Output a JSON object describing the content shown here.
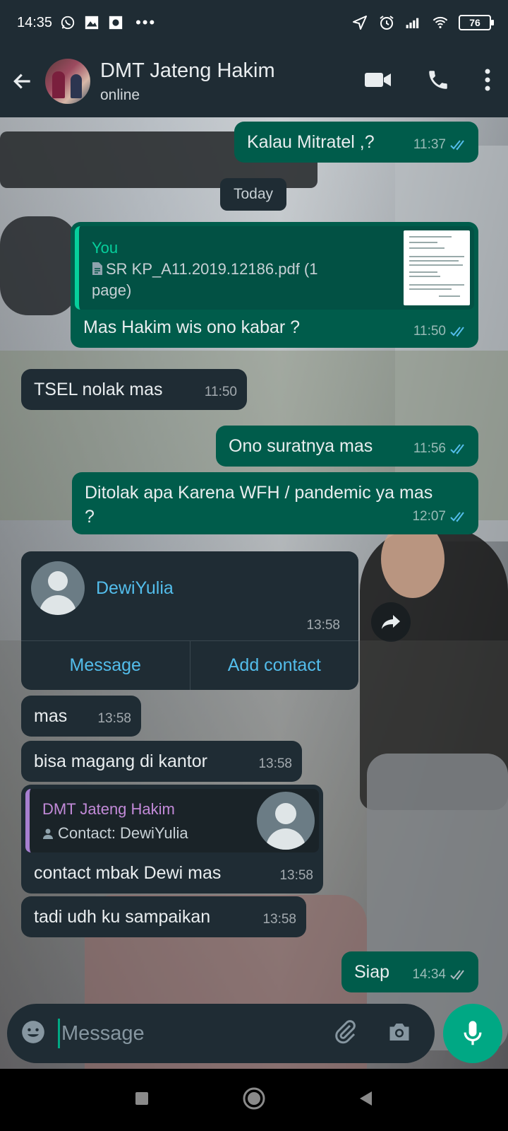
{
  "status_bar": {
    "time": "14:35",
    "battery": "76",
    "icons": [
      "whatsapp-icon",
      "gallery-icon",
      "square-icon",
      "more-dots-icon",
      "location-icon",
      "alarm-icon",
      "signal-icon",
      "wifi-icon",
      "battery-icon"
    ]
  },
  "header": {
    "name": "DMT Jateng Hakim",
    "status": "online"
  },
  "chat": {
    "day_divider": "Today",
    "messages": [
      {
        "text": "Kalau Mitratel ,?",
        "time": "11:37"
      },
      {
        "quote_author": "You",
        "quote_doc": "SR KP_A11.2019.12186.pdf (1 page)",
        "text": "Mas Hakim wis ono kabar ?",
        "time": "11:50"
      },
      {
        "text": "TSEL nolak mas",
        "time": "11:50"
      },
      {
        "text": "Ono suratnya mas",
        "time": "11:56"
      },
      {
        "text": "Ditolak apa Karena WFH / pandemic ya mas ?",
        "time": "12:07"
      },
      {
        "text": "mas",
        "time": "13:58"
      },
      {
        "text": "bisa magang di kantor",
        "time": "13:58"
      },
      {
        "quote_author": "DMT Jateng Hakim",
        "quote_text": "Contact: DewiYulia",
        "text": "contact mbak Dewi mas",
        "time": "13:58"
      },
      {
        "text": "tadi udh ku sampaikan",
        "time": "13:58"
      },
      {
        "text": "Siap",
        "time": "14:34"
      }
    ],
    "contact_card": {
      "name": "DewiYulia",
      "time": "13:58",
      "message_label": "Message",
      "add_contact_label": "Add contact"
    }
  },
  "input": {
    "placeholder": "Message"
  },
  "colors": {
    "outgoing_bubble": "#005c4b",
    "incoming_bubble": "#1f2c34",
    "accent": "#00a884",
    "link": "#53bdeb",
    "read_ticks": "#53bdeb"
  }
}
